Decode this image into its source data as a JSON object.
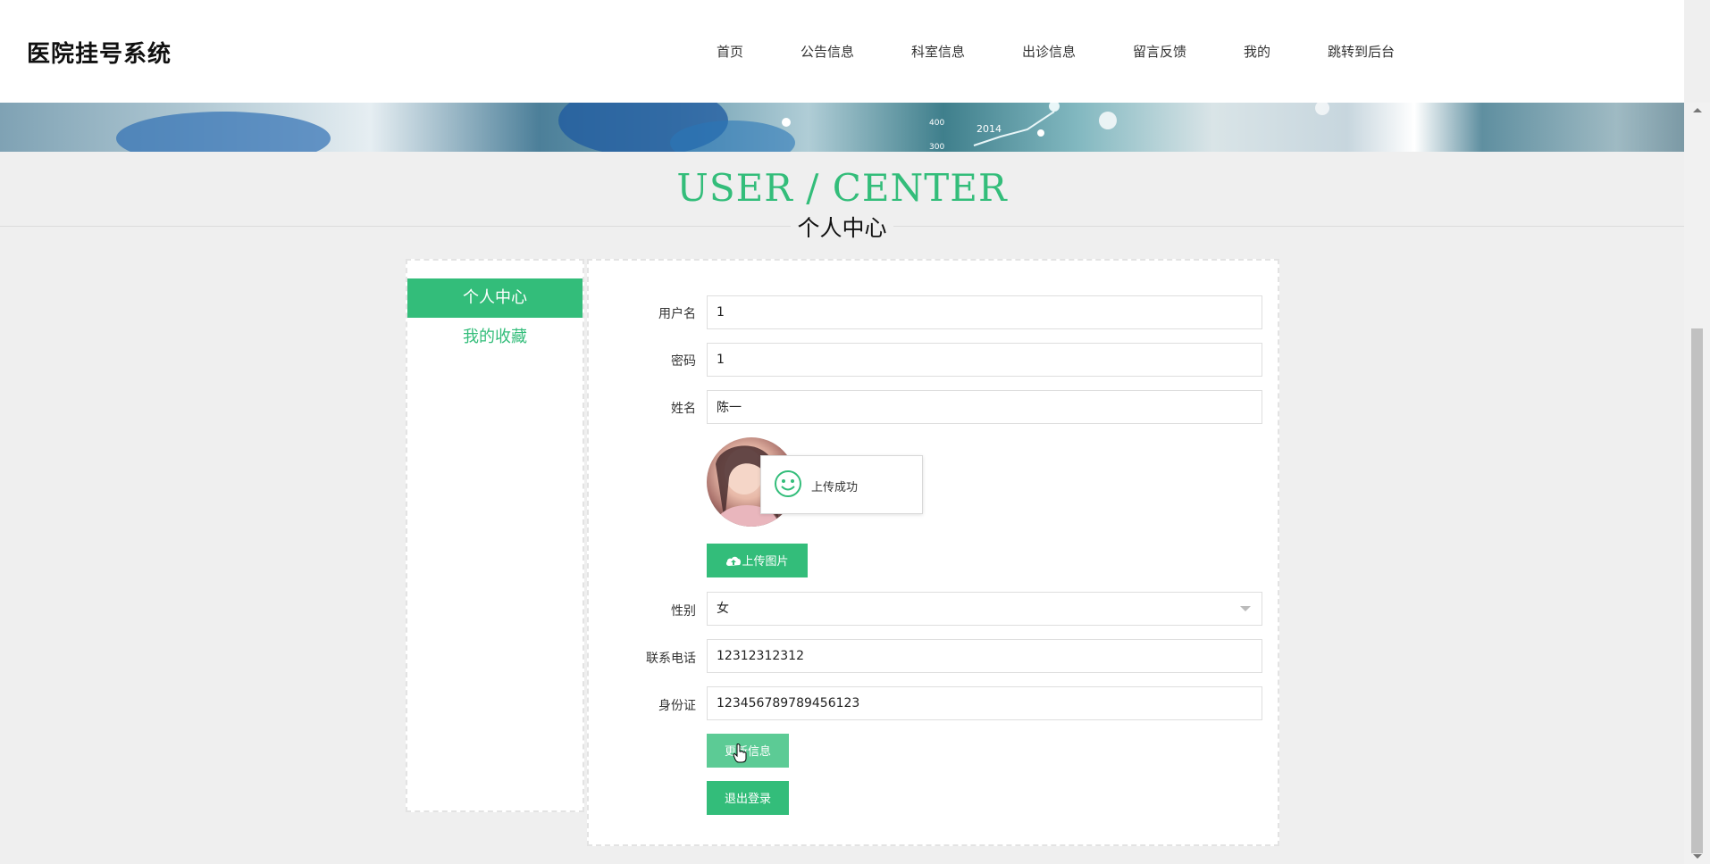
{
  "app": {
    "title": "医院挂号系统"
  },
  "nav": {
    "items": [
      {
        "label": "首页"
      },
      {
        "label": "公告信息"
      },
      {
        "label": "科室信息"
      },
      {
        "label": "出诊信息"
      },
      {
        "label": "留言反馈"
      },
      {
        "label": "我的"
      },
      {
        "label": "跳转到后台"
      }
    ]
  },
  "heading": {
    "en": "USER / CENTER",
    "cn": "个人中心"
  },
  "sidebar": {
    "active": "个人中心",
    "items": [
      {
        "label": "我的收藏"
      }
    ]
  },
  "form": {
    "username": {
      "label": "用户名",
      "value": "1"
    },
    "password": {
      "label": "密码",
      "value": "1"
    },
    "name": {
      "label": "姓名",
      "value": "陈一"
    },
    "upload_button": "上传图片",
    "gender": {
      "label": "性别",
      "value": "女"
    },
    "phone": {
      "label": "联系电话",
      "value": "12312312312"
    },
    "id_card": {
      "label": "身份证",
      "value": "123456789789456123"
    },
    "update_button": "更新信息",
    "logout_button": "退出登录"
  },
  "toast": {
    "text": "上传成功",
    "icon": "smile-icon"
  },
  "banner": {
    "chart_labels": [
      "400",
      "300",
      "2014"
    ]
  },
  "colors": {
    "accent": "#33bd7a",
    "background": "#efefef"
  }
}
